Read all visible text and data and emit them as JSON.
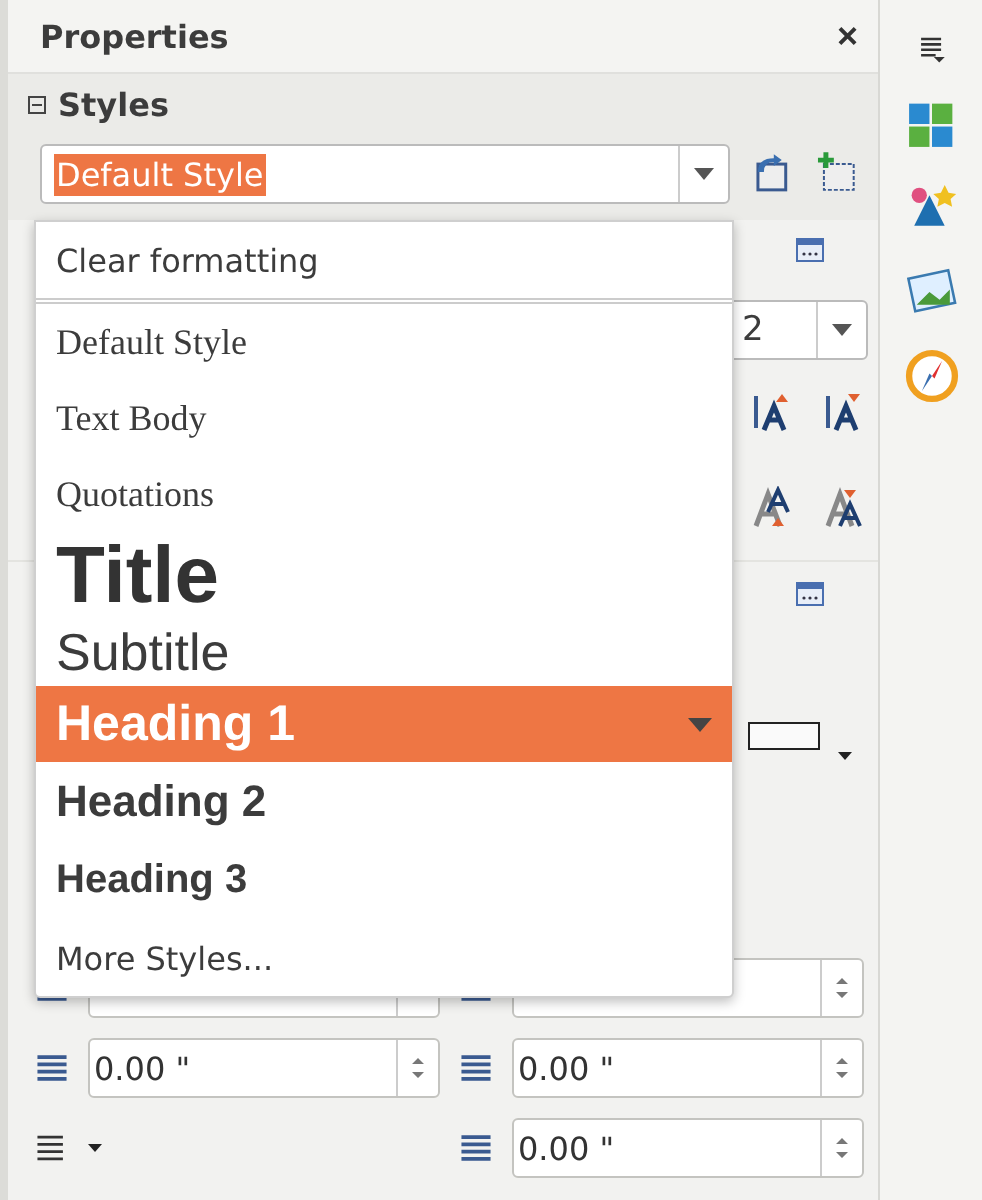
{
  "panel": {
    "title": "Properties",
    "close": "×"
  },
  "styles_section": {
    "title": "Styles",
    "expanded": true,
    "style_box": {
      "value": "Default Style"
    }
  },
  "style_menu": {
    "items": [
      {
        "label": "Clear formatting",
        "kind": "clear",
        "selected": false
      },
      {
        "label": "Default Style",
        "kind": "body",
        "selected": false
      },
      {
        "label": "Text Body",
        "kind": "body",
        "selected": false
      },
      {
        "label": "Quotations",
        "kind": "body",
        "selected": false
      },
      {
        "label": "Title",
        "kind": "title",
        "selected": false
      },
      {
        "label": "Subtitle",
        "kind": "subtitle",
        "selected": false
      },
      {
        "label": "Heading 1",
        "kind": "heading1",
        "selected": true
      },
      {
        "label": "Heading 2",
        "kind": "heading2",
        "selected": false
      },
      {
        "label": "Heading 3",
        "kind": "heading3",
        "selected": false
      },
      {
        "label": "More Styles...",
        "kind": "more",
        "selected": false
      }
    ]
  },
  "font_size": {
    "value": "2"
  },
  "spacing_rows": [
    {
      "left": "0.00 \"",
      "right": "0.00 \""
    },
    {
      "right": "0.00 \""
    }
  ]
}
